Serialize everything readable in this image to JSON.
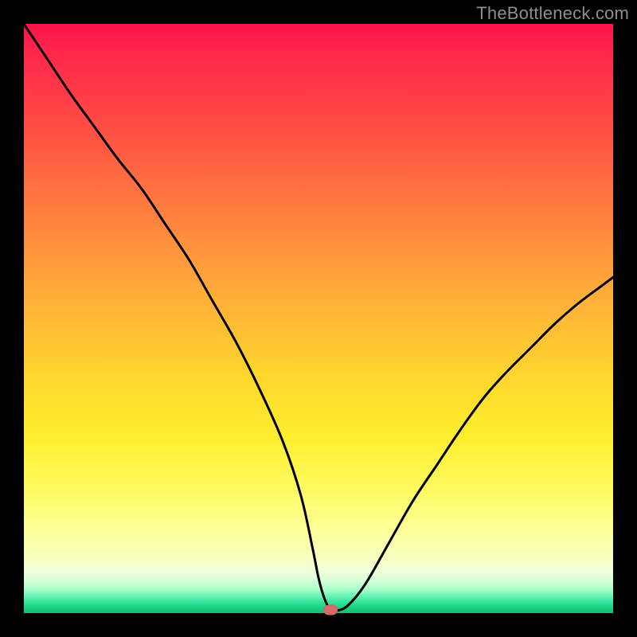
{
  "watermark": {
    "text": "TheBottleneck.com"
  },
  "colors": {
    "frame_bg": "#000000",
    "curve": "#000000",
    "marker": "#d96a6a"
  },
  "chart_data": {
    "type": "line",
    "title": "",
    "xlabel": "",
    "ylabel": "",
    "xlim": [
      0,
      100
    ],
    "ylim": [
      0,
      100
    ],
    "grid": false,
    "legend": false,
    "annotations": [
      {
        "name": "minimum-marker",
        "x": 52,
        "y": 0,
        "shape": "pill",
        "color": "#d96a6a"
      }
    ],
    "note": "V-shaped bottleneck curve; y is bottleneck magnitude (0 = no bottleneck). x is relative component score. Values estimated from pixel positions.",
    "series": [
      {
        "name": "bottleneck-curve",
        "x": [
          0,
          4,
          8,
          12,
          16,
          20,
          24,
          28,
          32,
          36,
          40,
          44,
          47,
          49,
          50,
          51,
          52,
          53,
          55,
          58,
          62,
          66,
          70,
          74,
          78,
          82,
          86,
          90,
          94,
          98,
          100
        ],
        "y": [
          100,
          94,
          88,
          82.5,
          77,
          72,
          66,
          60,
          53,
          46,
          38,
          29,
          20,
          11,
          6,
          2.5,
          0.6,
          0.4,
          1.3,
          5,
          12,
          19,
          25,
          31,
          36.5,
          41,
          45,
          49,
          52.5,
          55.5,
          57
        ]
      }
    ]
  }
}
